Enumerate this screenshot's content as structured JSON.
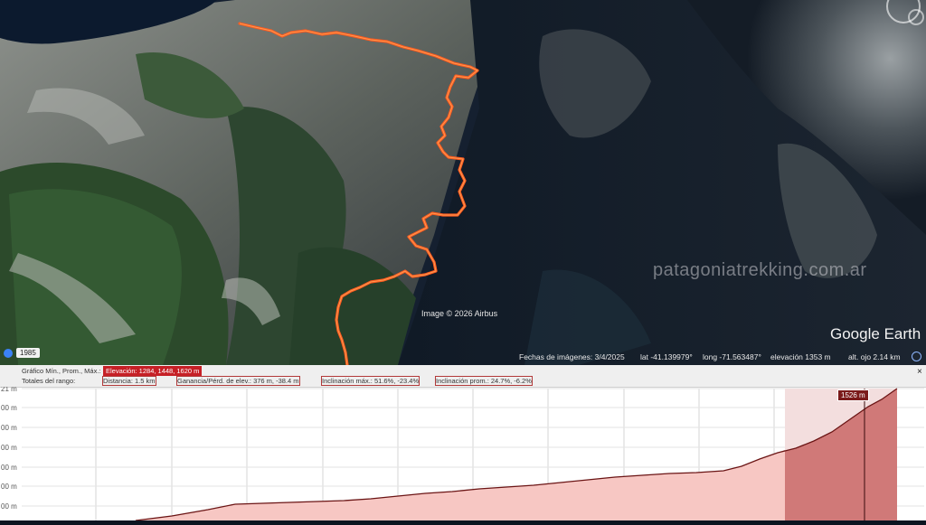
{
  "map": {
    "watermark": "patagoniatrekking.com.ar",
    "image_credit": "Image © 2026 Airbus",
    "logo_google": "Google",
    "logo_earth": "Earth",
    "year_badge": "1985",
    "track_color": "#ff5a1f",
    "status": {
      "date": "Fechas de imágenes: 3/4/2025",
      "lat": "lat  -41.139979°",
      "long": "long  -71.563487°",
      "elevation": "elevación  1353 m",
      "eye_alt": "alt. ojo  2.14 km"
    }
  },
  "profile": {
    "row1_label": "Gráfico  Mín., Prom., Máx.:",
    "elevation_range": "Elevación: 1284, 1448, 1620 m",
    "row2_label": "Totales del rango:",
    "distance": "Distancia: 1.5 km",
    "gain_loss": "Ganancia/Pérd. de elev.: 376 m, -38.4 m",
    "max_slope": "Inclinación máx.: 51.6%, -23.4%",
    "avg_slope": "Inclinación prom.: 24.7%, -6.2%",
    "close": "×",
    "tooltip": "1526 m",
    "y_ticks": [
      "21 m",
      "00 m",
      "00 m",
      "00 m",
      "00 m",
      "00 m",
      "00 m"
    ],
    "fill_color": "#f7c7c3",
    "selected_fill_color": "#c96b6b",
    "line_color": "#6b1515"
  }
}
